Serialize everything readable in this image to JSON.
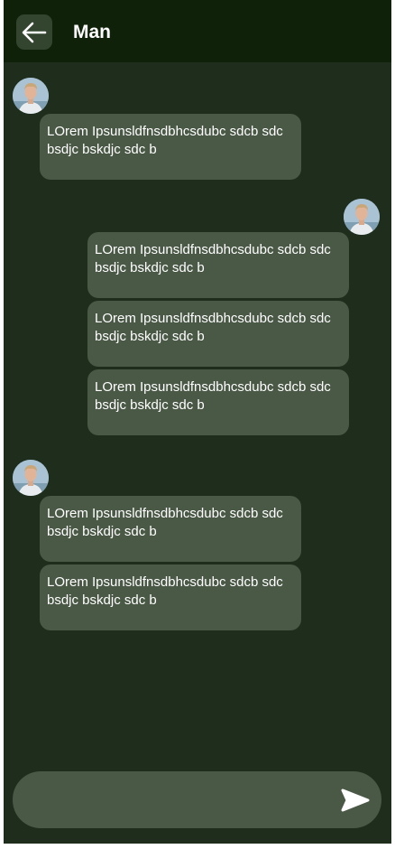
{
  "header": {
    "title": "Man",
    "back_icon": "arrow-left-icon"
  },
  "messages": [
    {
      "sender": "contact",
      "text": "LOrem Ipsunsldfnsdbhcsdubc sdcb sdc bsdjc bskdjc sdc b"
    },
    {
      "sender": "me",
      "text": "LOrem Ipsunsldfnsdbhcsdubc sdcb sdc bsdjc bskdjc sdc b"
    },
    {
      "sender": "me",
      "text": "LOrem Ipsunsldfnsdbhcsdubc sdcb sdc bsdjc bskdjc sdc b"
    },
    {
      "sender": "me",
      "text": "LOrem Ipsunsldfnsdbhcsdubc sdcb sdc bsdjc bskdjc sdc b"
    },
    {
      "sender": "contact",
      "text": "LOrem Ipsunsldfnsdbhcsdubc sdcb sdc bsdjc bskdjc sdc b"
    },
    {
      "sender": "contact",
      "text": "LOrem Ipsunsldfnsdbhcsdubc sdcb sdc bsdjc bskdjc sdc b"
    }
  ],
  "composer": {
    "value": "",
    "placeholder": "",
    "send_icon": "send-icon"
  },
  "colors": {
    "background": "#1f2e1c",
    "header": "#0f2209",
    "bubble": "#4a5846",
    "text": "#ffffff"
  }
}
